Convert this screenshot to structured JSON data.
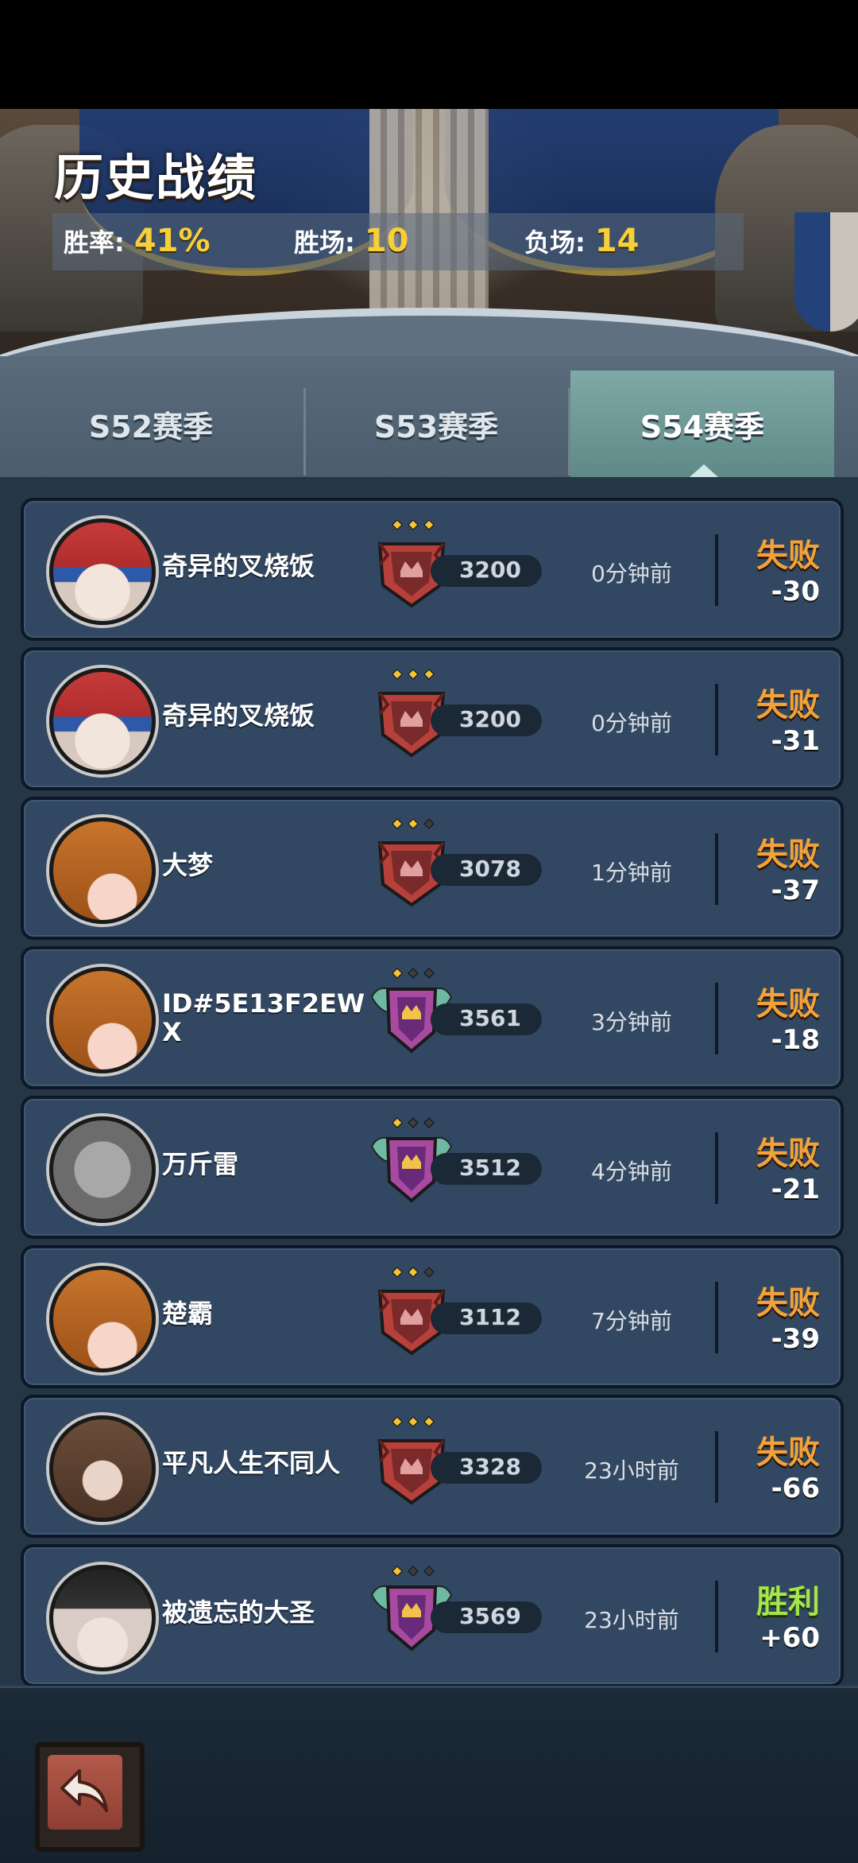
{
  "header": {
    "title": "历史战绩",
    "stats": [
      {
        "label": "胜率:",
        "value": "41%"
      },
      {
        "label": "胜场:",
        "value": "10"
      },
      {
        "label": "负场:",
        "value": "14"
      }
    ]
  },
  "tabs": [
    {
      "label": "S52赛季",
      "selected": false
    },
    {
      "label": "S53赛季",
      "selected": false
    },
    {
      "label": "S54赛季",
      "selected": true
    }
  ],
  "matches": [
    {
      "name": "奇异的叉烧饭",
      "avatar": "jester-avatar",
      "rank_tier": "bronze",
      "stars": 3,
      "score": "3200",
      "time": "0分钟前",
      "result": "失败",
      "change": "-30"
    },
    {
      "name": "奇异的叉烧饭",
      "avatar": "jester-avatar",
      "rank_tier": "bronze",
      "stars": 3,
      "score": "3200",
      "time": "0分钟前",
      "result": "失败",
      "change": "-31"
    },
    {
      "name": "大梦",
      "avatar": "pumpkin-avatar",
      "rank_tier": "bronze",
      "stars": 2,
      "score": "3078",
      "time": "1分钟前",
      "result": "失败",
      "change": "-37"
    },
    {
      "name": "ID#5E13F2EWX",
      "avatar": "pumpkin-avatar",
      "rank_tier": "winged",
      "stars": 1,
      "score": "3561",
      "time": "3分钟前",
      "result": "失败",
      "change": "-18"
    },
    {
      "name": "万斤雷",
      "avatar": "robot-avatar",
      "rank_tier": "winged",
      "stars": 1,
      "score": "3512",
      "time": "4分钟前",
      "result": "失败",
      "change": "-21"
    },
    {
      "name": "楚霸",
      "avatar": "pumpkin-avatar",
      "rank_tier": "bronze",
      "stars": 2,
      "score": "3112",
      "time": "7分钟前",
      "result": "失败",
      "change": "-39"
    },
    {
      "name": "平凡人生不同人",
      "avatar": "monkey-avatar",
      "rank_tier": "bronze",
      "stars": 3,
      "score": "3328",
      "time": "23小时前",
      "result": "失败",
      "change": "-66"
    },
    {
      "name": "被遗忘的大圣",
      "avatar": "thief-avatar",
      "rank_tier": "winged",
      "stars": 1,
      "score": "3569",
      "time": "23小时前",
      "result": "胜利",
      "change": "+60"
    }
  ],
  "colors": {
    "loss": "#f2a23a",
    "win": "#a6e548",
    "stat_value": "#f6cf3b",
    "star_on": "#f6c432",
    "star_off": "#3d3d3d"
  },
  "bottom": {
    "back_icon": "return-arrow-icon"
  }
}
